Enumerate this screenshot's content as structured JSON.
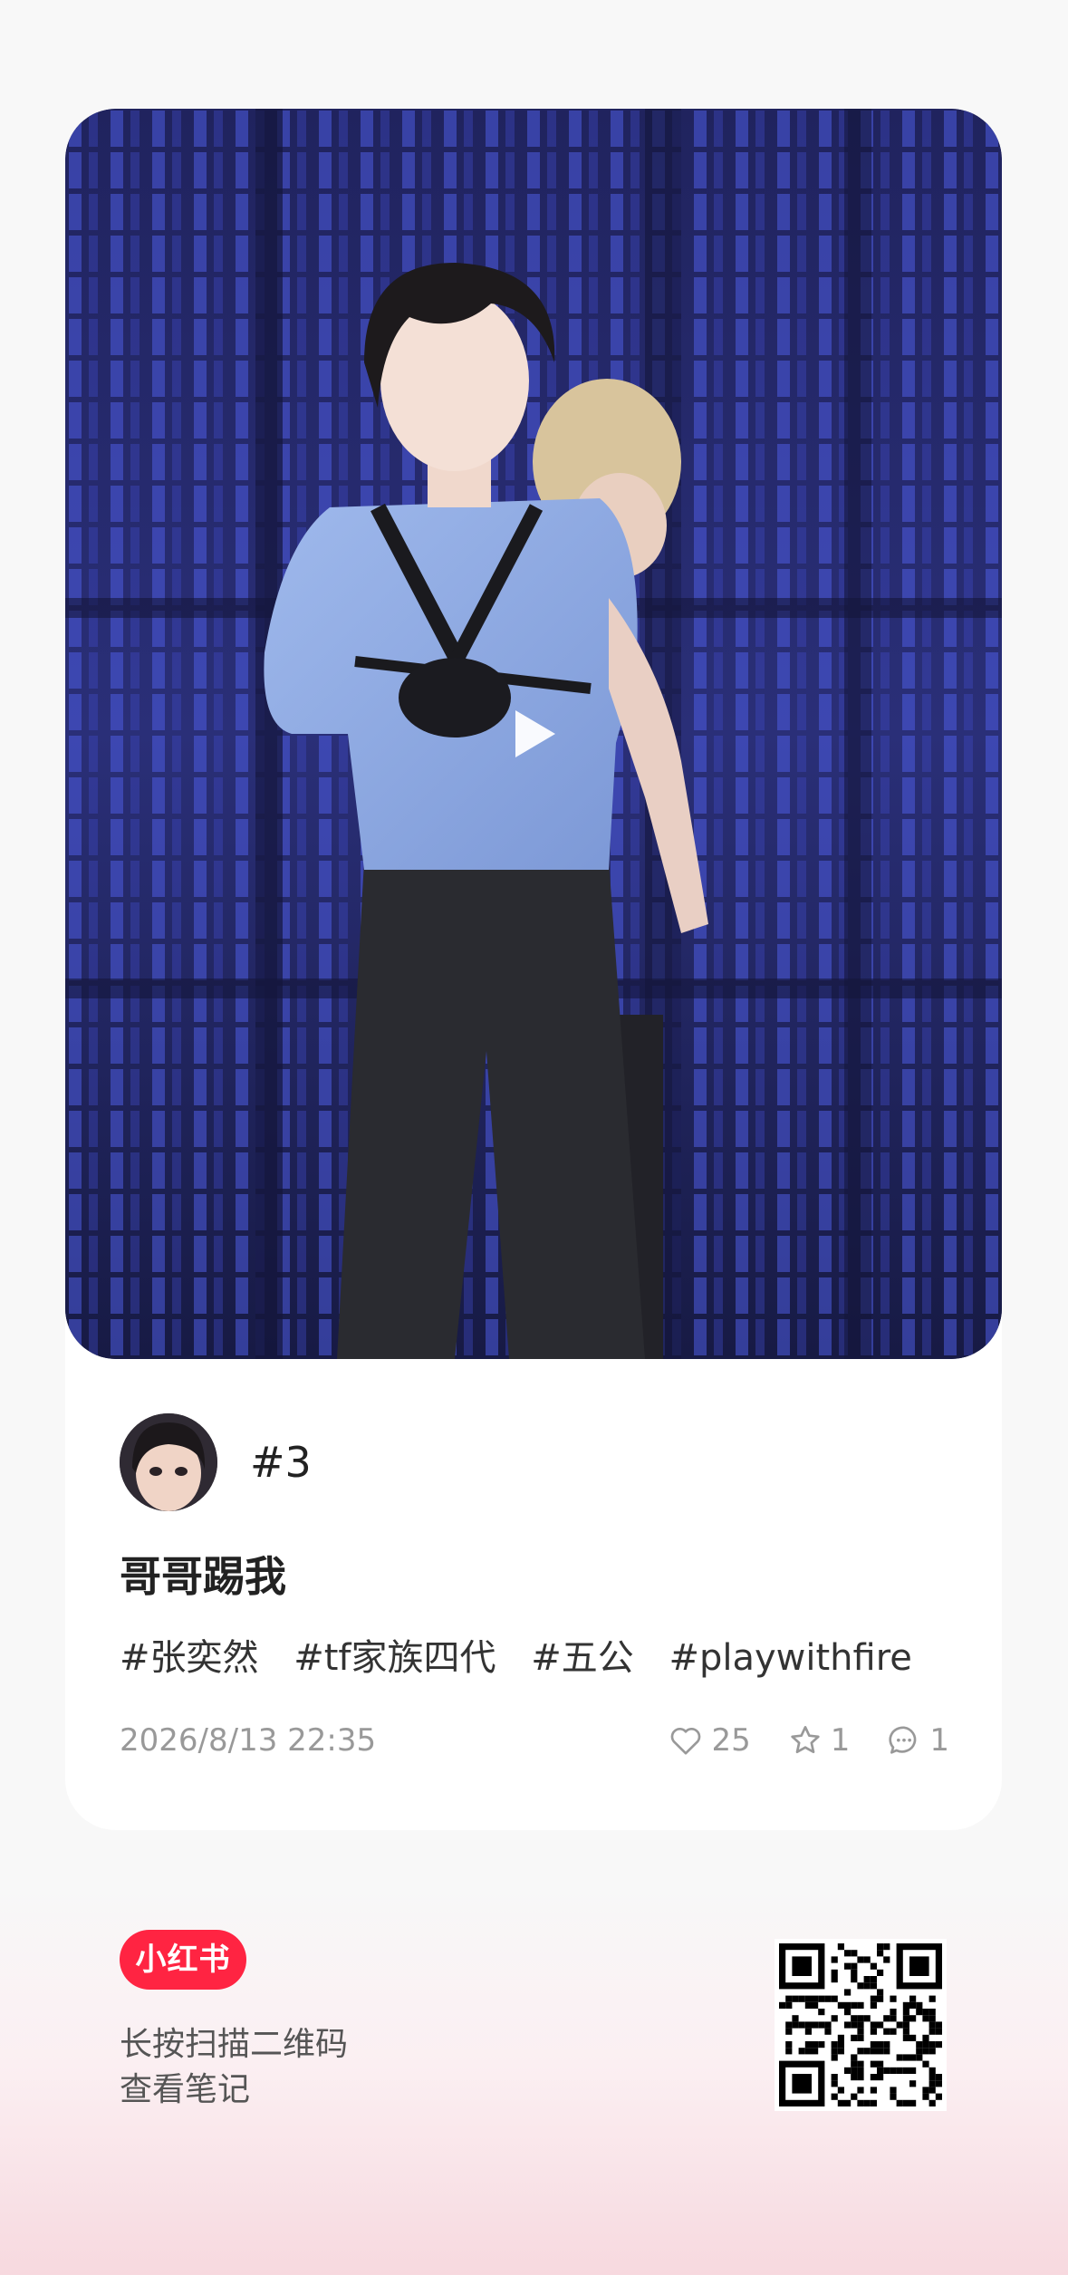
{
  "post": {
    "author": "#3",
    "title": "哥哥踢我",
    "tags": [
      "#张奕然",
      "#tf家族四代",
      "#五公",
      "#playwithfire"
    ],
    "date": "2026/8/13  22:35",
    "likes": "25",
    "collects": "1",
    "comments": "1"
  },
  "footer": {
    "brand": "小红书",
    "hint_line1": "长按扫描二维码",
    "hint_line2": "查看笔记"
  },
  "icons": {
    "play": "play-icon",
    "like": "heart-icon",
    "collect": "star-icon",
    "comment": "comment-icon"
  },
  "colors": {
    "brand": "#ff2442",
    "stage": "#1c1e52",
    "stage_light": "#4a55d8"
  }
}
